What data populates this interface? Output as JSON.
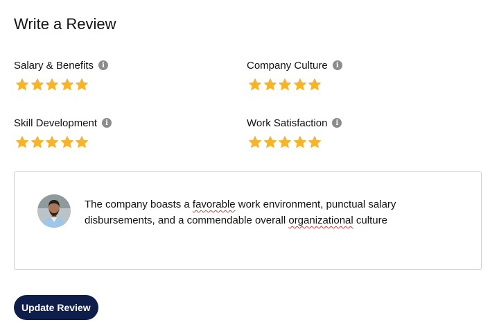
{
  "page": {
    "title": "Write a Review"
  },
  "ratings": [
    {
      "label": "Salary & Benefits",
      "stars": 5,
      "max": 5,
      "info_icon": "info-icon"
    },
    {
      "label": "Company Culture",
      "stars": 5,
      "max": 5,
      "info_icon": "info-icon"
    },
    {
      "label": "Skill Development",
      "stars": 5,
      "max": 5,
      "info_icon": "info-icon"
    },
    {
      "label": "Work Satisfaction",
      "stars": 5,
      "max": 5,
      "info_icon": "info-icon"
    }
  ],
  "review": {
    "parts": [
      "The company boasts a ",
      "favorable",
      " work environment, punctual salary disbursements, and a commendable overall ",
      "organizational",
      " culture"
    ]
  },
  "actions": {
    "update_label": "Update Review"
  },
  "colors": {
    "star": "#f6b42b",
    "button": "#0e1d4a",
    "info": "#8c8c8c",
    "spellcheck": "#d43a3a"
  }
}
